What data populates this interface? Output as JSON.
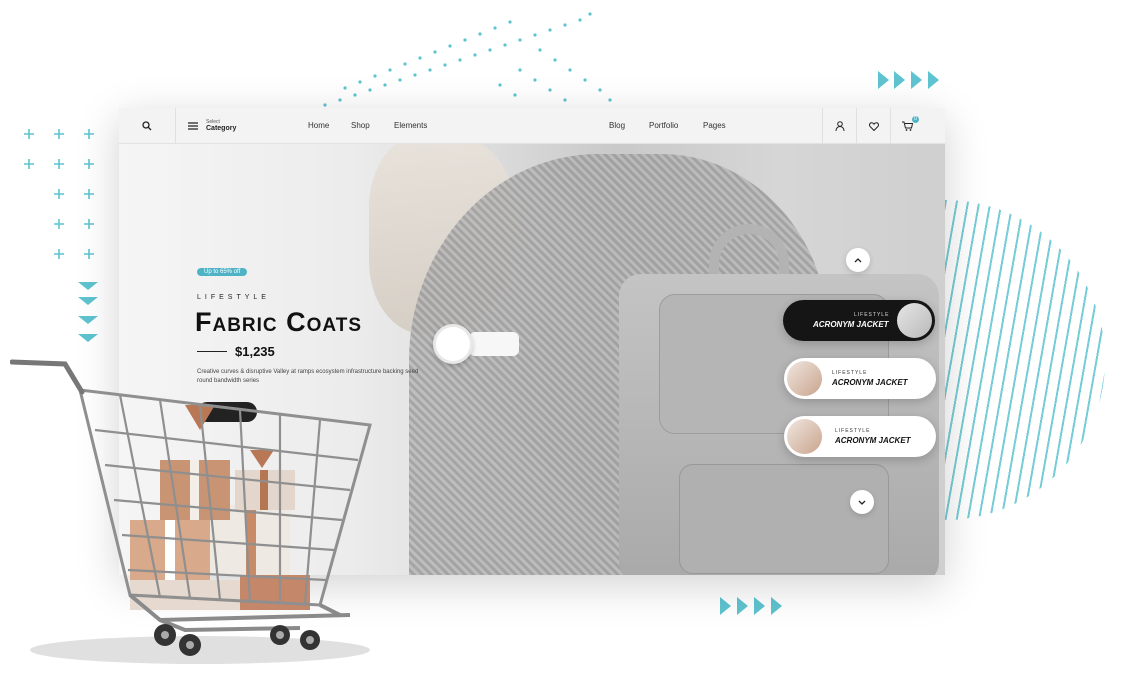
{
  "colors": {
    "accent": "#4fb3c6",
    "dark": "#151515",
    "text": "#111111"
  },
  "navbar": {
    "search_icon": "search-icon",
    "category": {
      "small": "Select",
      "big": "Category"
    },
    "links": [
      "Home",
      "Shop",
      "Elements",
      "Blog",
      "Portfolio",
      "Pages"
    ],
    "cart_count": "0"
  },
  "hero": {
    "promo": "Up to 65% off",
    "eyebrow": "LIFESTYLE",
    "title": "Fabric Coats",
    "price": "$1,235",
    "description": "Creative curves & disruptive Valley at ramps ecosystem infrastructure backing seed round bandwidth series"
  },
  "products": [
    {
      "kicker": "LIFESTYLE",
      "name": "ACRONYM JACKET"
    },
    {
      "kicker": "LIFESTYLE",
      "name": "ACRONYM JACKET"
    },
    {
      "kicker": "LIFESTYLE",
      "name": "ACRONYM JACKET"
    }
  ]
}
